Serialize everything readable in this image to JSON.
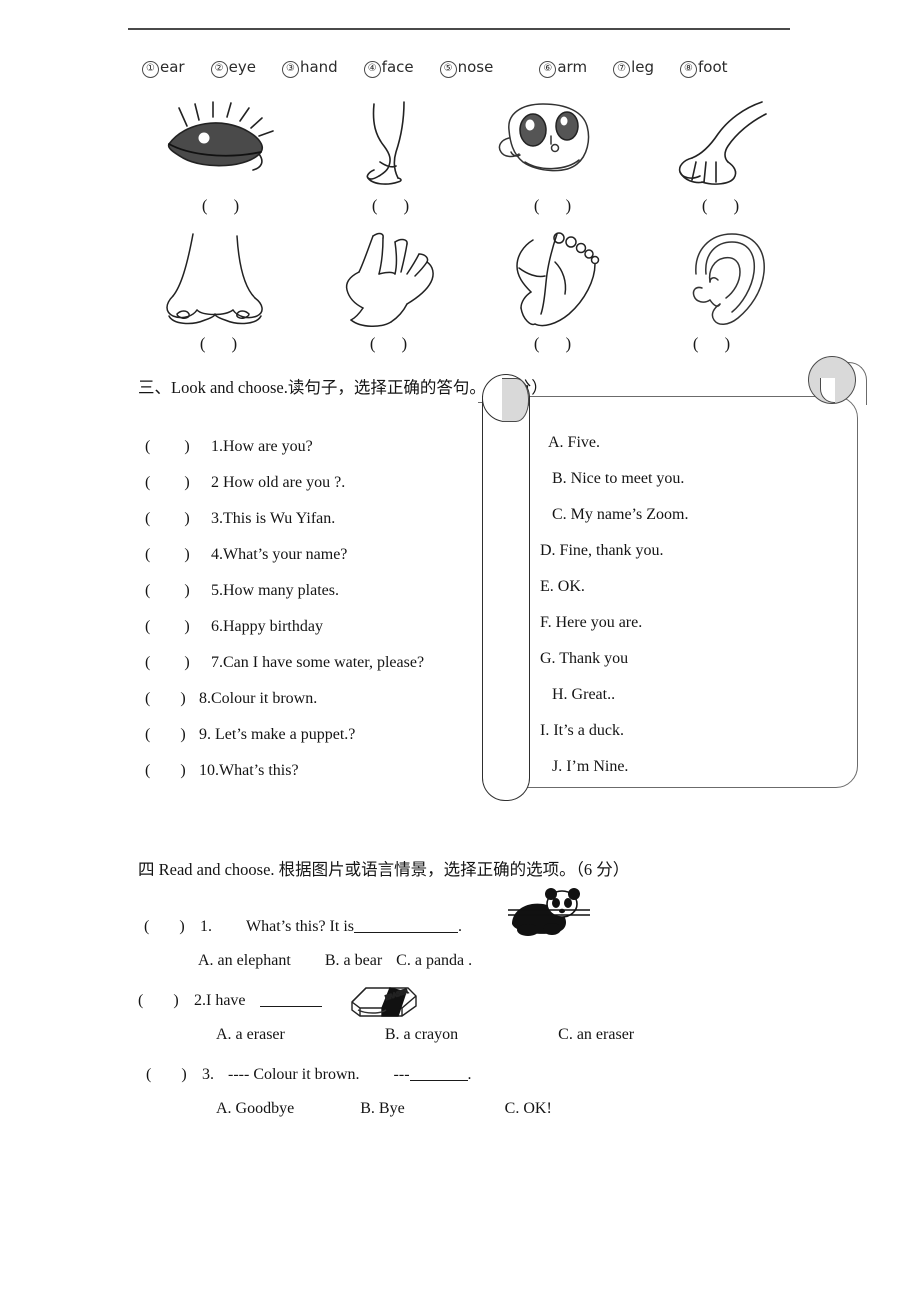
{
  "word_bank": {
    "items": [
      {
        "num": "①",
        "word": "ear"
      },
      {
        "num": "②",
        "word": "eye"
      },
      {
        "num": "③",
        "word": "hand"
      },
      {
        "num": "④",
        "word": "face"
      },
      {
        "num": "⑤",
        "word": "nose"
      },
      {
        "num": "⑥",
        "word": "arm"
      },
      {
        "num": "⑦",
        "word": "leg"
      },
      {
        "num": "⑧",
        "word": "foot"
      }
    ]
  },
  "picture_grid": {
    "answer_blank": "(",
    "answer_blank_close": ")",
    "rows": [
      [
        {
          "icon": "eye-drawing",
          "answer_blank": "(          )"
        },
        {
          "icon": "leg-drawing",
          "answer_blank": "(          )"
        },
        {
          "icon": "face-drawing",
          "answer_blank": "(          )"
        },
        {
          "icon": "arm-drawing",
          "answer_blank": "(          )"
        }
      ],
      [
        {
          "icon": "nose-drawing",
          "answer_blank": "(          )"
        },
        {
          "icon": "hand-drawing",
          "answer_blank": "(          )"
        },
        {
          "icon": "foot-drawing",
          "answer_blank": "(          )"
        },
        {
          "icon": "ear-drawing",
          "answer_blank": "(          )"
        }
      ]
    ]
  },
  "section3": {
    "heading": "三、Look and choose.读句子，选择正确的答句。（10 分）",
    "questions": [
      {
        "paren": "(",
        "paren_close": ")",
        "text": "1.How are you?"
      },
      {
        "paren": "(",
        "paren_close": ")",
        "text": "2 How old are you ?."
      },
      {
        "paren": "(",
        "paren_close": ")",
        "text": "3.This is Wu Yifan."
      },
      {
        "paren": "(",
        "paren_close": ")",
        "text": "4.What’s your name?"
      },
      {
        "paren": "(",
        "paren_close": ")",
        "text": "5.How many plates."
      },
      {
        "paren": "(",
        "paren_close": ")",
        "text": "6.Happy birthday"
      },
      {
        "paren": "(",
        "paren_close": ")",
        "text": "7.Can I have some water, please?"
      },
      {
        "paren": "(",
        "paren_close": ")",
        "text": "8.Colour   it brown."
      },
      {
        "paren": "(",
        "paren_close": ")",
        "text": "9. Let’s make a puppet.?"
      },
      {
        "paren": "(",
        "paren_close": ")",
        "text": "10.What’s this?"
      }
    ],
    "answers": [
      "A. Five.",
      "B. Nice to meet you.",
      "C. My name’s Zoom.",
      "D. Fine, thank you.",
      "E. OK.",
      "F. Here you are.",
      "G. Thank you",
      "H. Great..",
      "I. It’s a duck.",
      "J. I’m Nine."
    ]
  },
  "section4": {
    "heading": "四  Read and choose. 根据图片或语言情景，选择正确的选项。（6 分）",
    "items": [
      {
        "paren": "(",
        "paren_close": ")",
        "number": "1.",
        "stem_before": "What’s this? It is",
        "stem_after": ".",
        "icon": "panda-drawing",
        "options": [
          "A. an elephant",
          "B. a bear",
          "C. a panda ."
        ]
      },
      {
        "paren": "(",
        "paren_close": ")",
        "number": "2.I have",
        "stem_before": "",
        "stem_after": "",
        "icon": "eraser-drawing",
        "options": [
          "A. a   eraser",
          "B. a crayon",
          "C. an eraser"
        ]
      },
      {
        "paren": "(",
        "paren_close": ")",
        "number": "3.",
        "stem_before": "---- Colour it brown.",
        "stem_after": "---",
        "stem_end": ".",
        "icon": "",
        "options": [
          "A. Goodbye",
          "B. Bye",
          "C. OK!"
        ]
      }
    ]
  },
  "colors": {
    "ink": "#1a1a1a",
    "rule": "#4a4a4a",
    "scroll_outline": "#6b6b6b",
    "scroll_curl_fill": "#d9d9d9"
  }
}
